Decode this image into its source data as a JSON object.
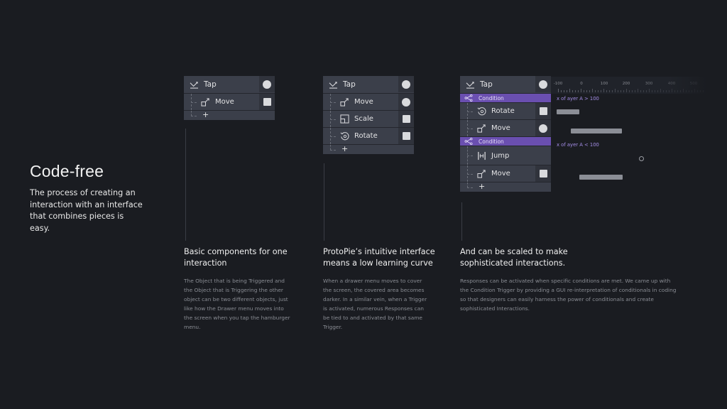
{
  "hero": {
    "title": "Code-free",
    "subtitle": "The process of creating an interaction with an interface that combines pieces is easy."
  },
  "panels": [
    {
      "trigger": {
        "label": "Tap",
        "icon": "tap-icon",
        "marker": "circle"
      },
      "responses": [
        {
          "label": "Move",
          "icon": "move-icon",
          "marker": "square"
        }
      ],
      "add_label": "+"
    },
    {
      "trigger": {
        "label": "Tap",
        "icon": "tap-icon",
        "marker": "circle"
      },
      "responses": [
        {
          "label": "Move",
          "icon": "move-icon",
          "marker": "circle"
        },
        {
          "label": "Scale",
          "icon": "scale-icon",
          "marker": "square"
        },
        {
          "label": "Rotate",
          "icon": "rotate-icon",
          "marker": "square"
        }
      ],
      "add_label": "+"
    },
    {
      "trigger": {
        "label": "Tap",
        "icon": "tap-icon",
        "marker": "circle"
      },
      "conditions": [
        {
          "label": "Condition",
          "expression": "x of ayer A > 100",
          "responses": [
            {
              "label": "Rotate",
              "icon": "rotate-icon",
              "marker": "square"
            },
            {
              "label": "Move",
              "icon": "move-icon",
              "marker": "circle"
            }
          ]
        },
        {
          "label": "Condition",
          "expression": "x of ayer A < 100",
          "responses": [
            {
              "label": "Jump",
              "icon": "jump-icon",
              "marker": "none"
            },
            {
              "label": "Move",
              "icon": "move-icon",
              "marker": "square"
            }
          ]
        }
      ],
      "add_label": "+"
    }
  ],
  "timeline": {
    "ruler_labels": [
      "-100",
      "0",
      "100",
      "200",
      "300",
      "400",
      "500"
    ]
  },
  "captions": [
    {
      "title": "Basic components for one interaction",
      "body": "The Object that is being Triggered and the Object that is Triggering the other object can be two different objects, just like how the Drawer menu moves into the screen when you tap the hamburger menu."
    },
    {
      "title": "ProtoPie’s intuitive interface means a low learning curve",
      "body": "When a drawer menu moves to cover the screen, the covered area becomes darker. In a similar vein, when a Trigger is activated, numerous Responses can be tied to and activated by that same Trigger."
    },
    {
      "title": "And can be scaled to make sophisticated interactions.",
      "body": "Responses can be activated when specific conditions are met. We came up with the Condition Trigger by providing a GUI re-interpretation of conditionals in coding so that designers can easily harness the power of conditionals and create sophisticated Interactions."
    }
  ]
}
